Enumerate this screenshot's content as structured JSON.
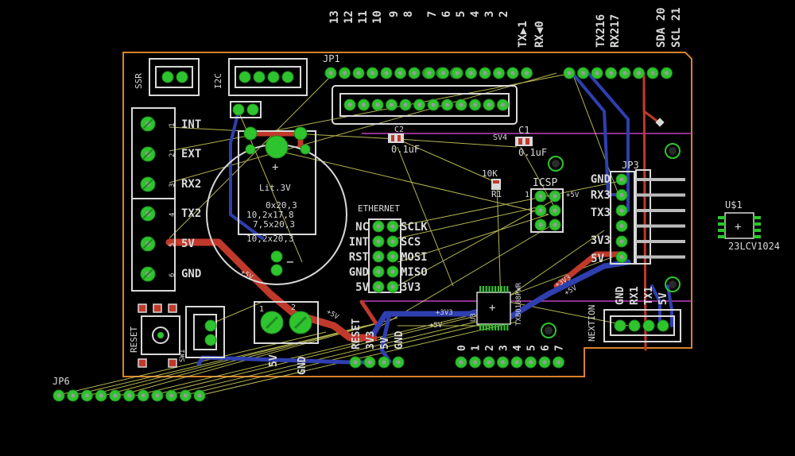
{
  "colors": {
    "background": "#000000",
    "board_outline": "#d9822b",
    "pad": "#2ec42e",
    "silkscreen": "#d9d9d9",
    "top_trace": "#c0392b",
    "bottom_trace": "#2f3fb0",
    "ratsnest": "#c8c85a",
    "magenta": "#c040c0"
  },
  "header_pins": {
    "left_group": [
      "13",
      "12",
      "11",
      "10",
      "9",
      "8"
    ],
    "right_group": [
      "7",
      "6",
      "5",
      "4",
      "3",
      "2"
    ],
    "tx": "TX▶1",
    "rx": "RX◀0",
    "tx2": "TX216",
    "rx2": "RX217",
    "sda": "SDA 20",
    "scl": "SCL 21"
  },
  "connectors": {
    "ssr": "SSR",
    "i2c": "I2C",
    "jp1": "JP1",
    "jp3": "JP3",
    "jp6": "JP6",
    "icsp": "ICSP",
    "ethernet": "ETHERNET",
    "nextion": "NEXTION",
    "u_chip": "U$1",
    "chip_part": "23LCV1024",
    "reset": "RESET",
    "sw": "SW1"
  },
  "terminal_block": {
    "labels": [
      "INT",
      "EXT",
      "RX2",
      "TX2",
      "5V",
      "GND"
    ],
    "numbers": [
      "1",
      "2",
      "3",
      "4",
      "5",
      "6"
    ]
  },
  "battery": {
    "label": "Lit.3V",
    "dims": [
      "0x20,3",
      "10,2x17,8",
      "7,5x20,3",
      "10,2x20,3"
    ]
  },
  "ethernet_pins": {
    "left": [
      "NC",
      "INT",
      "RST",
      "GND",
      "5V"
    ],
    "right": [
      "SCLK",
      "SCS",
      "MOSI",
      "MISO",
      "3V3"
    ]
  },
  "components": {
    "c2": "C2",
    "c2_val": "0.1uF",
    "c1": "C1",
    "c1_val": "0.1uF",
    "c_sv": "SV4",
    "r1": "R1",
    "r1_val": "10K",
    "ic_label": "U3",
    "ic_part": "TXB0108PWR"
  },
  "jp3_labels": [
    "GND",
    "RX3",
    "TX3",
    "3V3",
    "5V"
  ],
  "bottom_left_labels": [
    "RESET",
    "3V3",
    "5V",
    "GND"
  ],
  "bottom_numbers": [
    "0",
    "1",
    "2",
    "3",
    "4",
    "5",
    "6",
    "7"
  ],
  "power_block": [
    "5V",
    "GND"
  ],
  "nextion_labels": [
    "GND",
    "RX1",
    "TX1",
    "5V"
  ],
  "net_labels": [
    "+5V",
    "+3V3",
    "+5V",
    "+3V3",
    "+5V",
    "+5V",
    "+5V"
  ]
}
